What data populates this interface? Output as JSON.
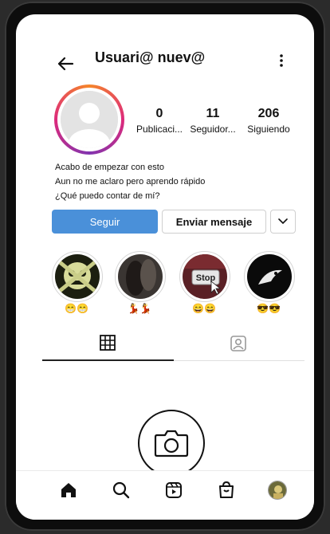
{
  "header": {
    "title": "Usuari@ nuev@"
  },
  "stats": [
    {
      "value": "0",
      "label": "Publicaci..."
    },
    {
      "value": "11",
      "label": "Seguidor..."
    },
    {
      "value": "206",
      "label": "Siguiendo"
    }
  ],
  "bio": {
    "line1": "Acabo de empezar con esto",
    "line2": "Aun no me aclaro pero aprendo rápido",
    "line3": "¿Qué puedo contar de mí?"
  },
  "actions": {
    "follow": "Seguir",
    "message": "Enviar mensaje"
  },
  "highlights": [
    {
      "label": "😁😁"
    },
    {
      "label": "💃💃"
    },
    {
      "label": "😄😄",
      "sign_text": "Stop"
    },
    {
      "label": "😎😎"
    }
  ],
  "colors": {
    "follow_button": "#4a90d9",
    "ring_start": "#f58529",
    "ring_end": "#8134af"
  },
  "icons": {
    "back": "arrow-left-icon",
    "menu": "more-vertical-icon",
    "more": "chevron-down-icon",
    "grid": "grid-icon",
    "tagged": "tagged-person-icon",
    "camera": "camera-icon",
    "nav": [
      "home-icon",
      "search-icon",
      "reels-icon",
      "shop-icon",
      "profile-avatar"
    ]
  }
}
